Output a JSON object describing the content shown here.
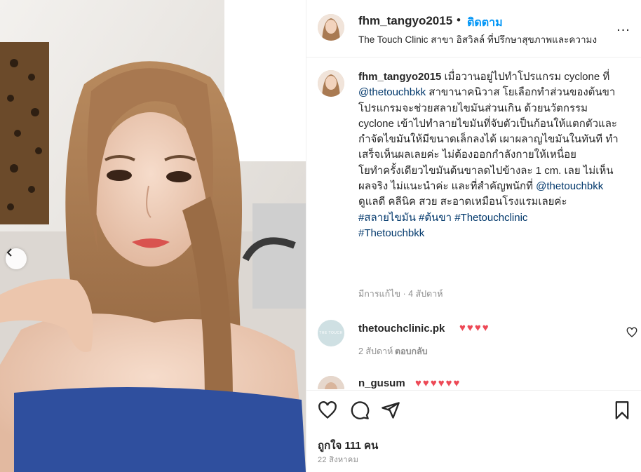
{
  "post": {
    "username": "fhm_tangyo2015",
    "separator": "•",
    "follow_label": "ติดตาม",
    "location": "The Touch Clinic สาขา อิสวิลล์ ที่ปรึกษาสุขภาพและความง",
    "more_icon": "more-horizontal-icon",
    "more_label": "..."
  },
  "caption": {
    "username": "fhm_tangyo2015",
    "part1": " เมื่อวานอยู่ไปทำโปรแกรม cyclone ที่ ",
    "mention1": "@thetouchbkk",
    "part2": " สาขานาคนิวาส โยเลือกทำส่วนของต้นขา โปรแกรมจะช่วยสลายไขมันส่วนเกิน ด้วยนวัตกรรม cyclone เข้าไปทำลายไขมันที่จับตัวเป็นก้อนให้แตกตัวและกำจัดไขมันให้มีขนาดเล็กลงได้ เผาผลาญไขมันในทันที ทำเสร็จเห็นผลเลยค่ะ ไม่ต้องออกกำลังกายให้เหนื่อย",
    "part3": "โยทำครั้งเดียวไขมันต้นขาลดไปข้างละ 1 cm. เลย ไม่เห็นผลจริง ไม่แนะนำค่ะ และที่สำคัญพนักที่ ",
    "mention2": "@thetouchbkk",
    "part4": " ดูแลดี คลีนิค สวย สะอาดเหมือนโรงแรมเลยค่ะ",
    "hashtags1": "#สลายไขมัน #ต้นขา #Thetouchclinic",
    "hashtags2": "#Thetouchbkk",
    "meta": "มีการแก้ไข · 4 สัปดาห์"
  },
  "comments": [
    {
      "username": "thetouchclinic.pk",
      "text": "♥♥♥♥",
      "time": "2 สัปดาห์",
      "reply_label": "ตอบกลับ",
      "avatar_text": "THE TOUCH"
    },
    {
      "username": "n_gusum",
      "text": "♥♥♥♥♥♥"
    }
  ],
  "actions": {
    "like_icon": "heart-icon",
    "comment_icon": "comment-icon",
    "share_icon": "share-icon",
    "save_icon": "bookmark-icon"
  },
  "likes": "ถูกใจ 111 คน",
  "date": "22 สิงหาคม",
  "colors": {
    "accent": "#0095f6",
    "hashtag": "#00376b",
    "heart": "#ed4956",
    "muted": "#8e8e8e"
  }
}
